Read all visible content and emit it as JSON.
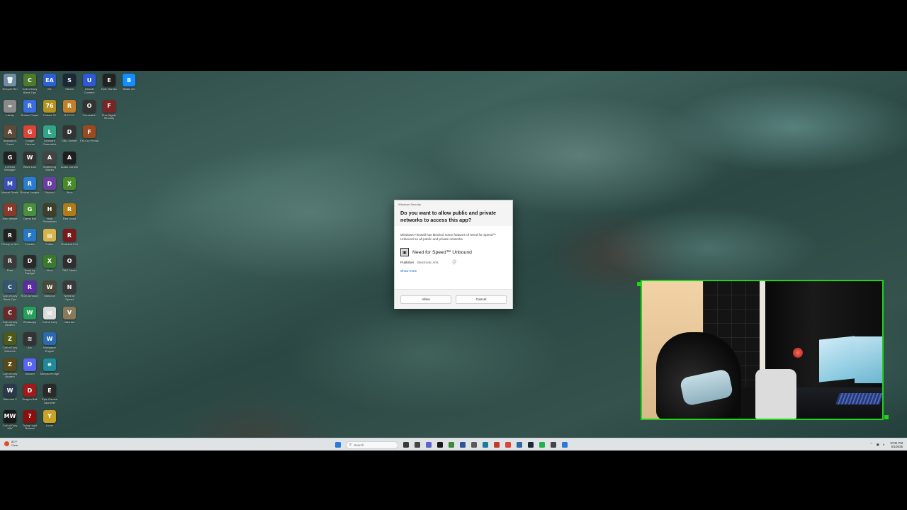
{
  "desktop": {
    "icons": [
      {
        "label": "Recycle Bin",
        "glyph": "🗑",
        "color": "#6f8da3"
      },
      {
        "label": "Call of Duty Black Ops",
        "glyph": "C",
        "color": "#4e7a2e"
      },
      {
        "label": "EA",
        "glyph": "EA",
        "color": "#2b5fd9"
      },
      {
        "label": "Steam",
        "glyph": "S",
        "color": "#1b2838"
      },
      {
        "label": "Ubisoft Connect",
        "glyph": "U",
        "color": "#2f59d4"
      },
      {
        "label": "Epic Games",
        "glyph": "E",
        "color": "#222222"
      },
      {
        "label": "Battle.net",
        "glyph": "B",
        "color": "#148eff"
      },
      {
        "label": "Infinity",
        "glyph": "∞",
        "color": "#8a8a8a"
      },
      {
        "label": "Roblox Player",
        "glyph": "R",
        "color": "#3a6ee0"
      },
      {
        "label": "Fallout 76",
        "glyph": "76",
        "color": "#b39222"
      },
      {
        "label": "R.E.P.O.",
        "glyph": "R",
        "color": "#c0802a"
      },
      {
        "label": "Overwatch",
        "glyph": "O",
        "color": "#333333"
      },
      {
        "label": "Five Nights Security",
        "glyph": "F",
        "color": "#7a2626"
      },
      {
        "label": "",
        "glyph": "",
        "color": "#000000"
      },
      {
        "label": "Assassin's Creed Shadows",
        "glyph": "A",
        "color": "#5e4a3a"
      },
      {
        "label": "Google Chrome",
        "glyph": "G",
        "color": "#db4437"
      },
      {
        "label": "Limewire Gamestick",
        "glyph": "L",
        "color": "#32a487"
      },
      {
        "label": "DBD Seeker",
        "glyph": "D",
        "color": "#333333"
      },
      {
        "label": "Far Cry Primal",
        "glyph": "F",
        "color": "#9b4a1f"
      },
      {
        "label": "",
        "glyph": "",
        "color": "#000000"
      },
      {
        "label": "",
        "glyph": "",
        "color": "#000000"
      },
      {
        "label": "LGHUB Manager",
        "glyph": "G",
        "color": "#222222"
      },
      {
        "label": "Wave Link",
        "glyph": "W",
        "color": "#333333"
      },
      {
        "label": "Wuthering Waves",
        "glyph": "A",
        "color": "#444444"
      },
      {
        "label": "Audio Control",
        "glyph": "A",
        "color": "#1f1f1f"
      },
      {
        "label": "",
        "glyph": "",
        "color": "#000000"
      },
      {
        "label": "",
        "glyph": "",
        "color": "#000000"
      },
      {
        "label": "",
        "glyph": "",
        "color": "#000000"
      },
      {
        "label": "Marvel Rivals",
        "glyph": "M",
        "color": "#3b4fb5"
      },
      {
        "label": "Rocket League",
        "glyph": "R",
        "color": "#2a7bd1"
      },
      {
        "label": "Discord",
        "glyph": "D",
        "color": "#6b3fa0"
      },
      {
        "label": "Xbox",
        "glyph": "X",
        "color": "#4b8a2a"
      },
      {
        "label": "",
        "glyph": "",
        "color": "#000000"
      },
      {
        "label": "",
        "glyph": "",
        "color": "#000000"
      },
      {
        "label": "",
        "glyph": "",
        "color": "#000000"
      },
      {
        "label": "Halo Infinite",
        "glyph": "H",
        "color": "#8a3a2a"
      },
      {
        "label": "Game Bar",
        "glyph": "G",
        "color": "#4a8f3a"
      },
      {
        "label": "Hunt Showdown",
        "glyph": "H",
        "color": "#3f3f2a"
      },
      {
        "label": "Red Dead",
        "glyph": "R",
        "color": "#b37a15"
      },
      {
        "label": "",
        "glyph": "",
        "color": "#000000"
      },
      {
        "label": "",
        "glyph": "",
        "color": "#000000"
      },
      {
        "label": "",
        "glyph": "",
        "color": "#000000"
      },
      {
        "label": "Ready or Not",
        "glyph": "R",
        "color": "#222222"
      },
      {
        "label": "Fortnite",
        "glyph": "F",
        "color": "#2878c8"
      },
      {
        "label": "Folder",
        "glyph": "▤",
        "color": "#d8b24a"
      },
      {
        "label": "Resident Evil",
        "glyph": "R",
        "color": "#7a1a1a"
      },
      {
        "label": "",
        "glyph": "",
        "color": "#000000"
      },
      {
        "label": "",
        "glyph": "",
        "color": "#000000"
      },
      {
        "label": "",
        "glyph": "",
        "color": "#000000"
      },
      {
        "label": "Rust",
        "glyph": "R",
        "color": "#3a3a3a"
      },
      {
        "label": "Dead by Daylight",
        "glyph": "D",
        "color": "#2a2a2a"
      },
      {
        "label": "Xbox",
        "glyph": "X",
        "color": "#3a7a2a"
      },
      {
        "label": "OBS Studio",
        "glyph": "O",
        "color": "#302e31"
      },
      {
        "label": "",
        "glyph": "",
        "color": "#000000"
      },
      {
        "label": "",
        "glyph": "",
        "color": "#000000"
      },
      {
        "label": "",
        "glyph": "",
        "color": "#000000"
      },
      {
        "label": "Call of Duty Black Ops",
        "glyph": "C",
        "color": "#36556e"
      },
      {
        "label": "ROG Armoury",
        "glyph": "R",
        "color": "#5a2da0"
      },
      {
        "label": "Warzone",
        "glyph": "W",
        "color": "#4a4a3a"
      },
      {
        "label": "Need for Speed",
        "glyph": "N",
        "color": "#3a3a3a"
      },
      {
        "label": "",
        "glyph": "",
        "color": "#000000"
      },
      {
        "label": "",
        "glyph": "",
        "color": "#000000"
      },
      {
        "label": "",
        "glyph": "",
        "color": "#000000"
      },
      {
        "label": "Call of Duty Modern",
        "glyph": "C",
        "color": "#6a2a2a"
      },
      {
        "label": "WhatsApp",
        "glyph": "W",
        "color": "#25a05a"
      },
      {
        "label": "Call of Duty",
        "glyph": "▤",
        "color": "#dcdcdc"
      },
      {
        "label": "Valorant",
        "glyph": "V",
        "color": "#8a7a5a"
      },
      {
        "label": "",
        "glyph": "",
        "color": "#000000"
      },
      {
        "label": "",
        "glyph": "",
        "color": "#000000"
      },
      {
        "label": "",
        "glyph": "",
        "color": "#000000"
      },
      {
        "label": "Call of Duty Warzone",
        "glyph": "Z",
        "color": "#4e5a1a"
      },
      {
        "label": "Arc",
        "glyph": "≋",
        "color": "#333333"
      },
      {
        "label": "Wallpaper Engine",
        "glyph": "W",
        "color": "#2a6ab0"
      },
      {
        "label": "",
        "glyph": "",
        "color": "#000000"
      },
      {
        "label": "",
        "glyph": "",
        "color": "#000000"
      },
      {
        "label": "",
        "glyph": "",
        "color": "#000000"
      },
      {
        "label": "",
        "glyph": "",
        "color": "#000000"
      },
      {
        "label": "Call of Duty Modern",
        "glyph": "Z",
        "color": "#5a4a1a"
      },
      {
        "label": "Discord",
        "glyph": "D",
        "color": "#5865f2"
      },
      {
        "label": "Microsoft Edge",
        "glyph": "e",
        "color": "#1f8a9a"
      },
      {
        "label": "",
        "glyph": "",
        "color": "#000000"
      },
      {
        "label": "",
        "glyph": "",
        "color": "#000000"
      },
      {
        "label": "",
        "glyph": "",
        "color": "#000000"
      },
      {
        "label": "",
        "glyph": "",
        "color": "#000000"
      },
      {
        "label": "Warzone 2",
        "glyph": "W",
        "color": "#2a3a4a"
      },
      {
        "label": "Dragon Ball",
        "glyph": "D",
        "color": "#a01a1a"
      },
      {
        "label": "Epic Games Launcher",
        "glyph": "E",
        "color": "#2a2a2a"
      },
      {
        "label": "",
        "glyph": "",
        "color": "#000000"
      },
      {
        "label": "",
        "glyph": "",
        "color": "#000000"
      },
      {
        "label": "",
        "glyph": "",
        "color": "#000000"
      },
      {
        "label": "",
        "glyph": "",
        "color": "#000000"
      },
      {
        "label": "Call of Duty MW",
        "glyph": "MW",
        "color": "#1a1a1a"
      },
      {
        "label": "Dying Light Retreat",
        "glyph": "?",
        "color": "#8a1010"
      },
      {
        "label": "Lunar",
        "glyph": "Y",
        "color": "#c9a227"
      }
    ]
  },
  "dialog": {
    "caption": "Windows Security",
    "title": "Do you want to allow public and private networks to access this app?",
    "body": "Windows Firewall has blocked some features of Need for Speed™ Unbound on all public and private networks.",
    "app_name": "Need for Speed™ Unbound",
    "publisher_label": "Publisher",
    "publisher_value": "Electronic Arts",
    "show_more": "Show more",
    "allow_label": "Allow",
    "cancel_label": "Cancel"
  },
  "webcam": {
    "border_color": "#22d317"
  },
  "taskbar": {
    "weather_temp": "83°F",
    "weather_desc": "Clear",
    "search_placeholder": "Search",
    "clock_time": "10:31 PM",
    "clock_date": "5/1/2025",
    "pinned": [
      {
        "name": "start-button",
        "color": "#2b7bd6"
      },
      {
        "name": "task-view",
        "color": "#3a3a3a"
      },
      {
        "name": "app-1",
        "color": "#444444"
      },
      {
        "name": "app-2",
        "color": "#5b64c9"
      },
      {
        "name": "app-3",
        "color": "#1a1a1a"
      },
      {
        "name": "app-4",
        "color": "#3a8a3a"
      },
      {
        "name": "app-5",
        "color": "#2b579a"
      },
      {
        "name": "app-6",
        "color": "#5a5a5a"
      },
      {
        "name": "app-7",
        "color": "#1f7a9a"
      },
      {
        "name": "app-8",
        "color": "#c23a2a"
      },
      {
        "name": "app-9",
        "color": "#db4437"
      },
      {
        "name": "app-10",
        "color": "#2a6aa0"
      },
      {
        "name": "app-11",
        "color": "#1b2838"
      },
      {
        "name": "app-12",
        "color": "#22b14c"
      },
      {
        "name": "app-13",
        "color": "#444444"
      },
      {
        "name": "app-14",
        "color": "#2b7bd6"
      }
    ]
  }
}
